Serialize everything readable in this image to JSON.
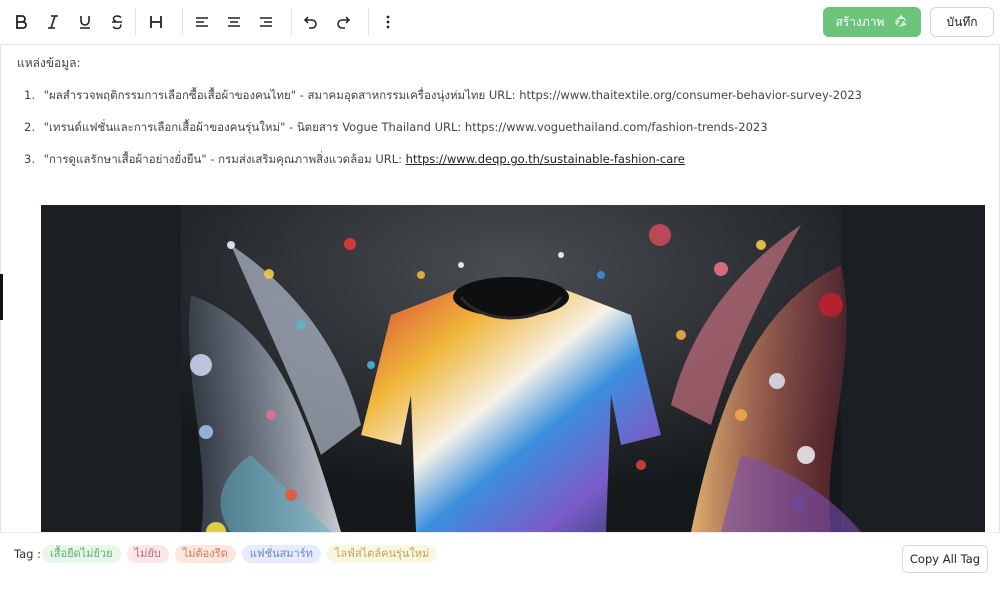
{
  "toolbar": {
    "tools": [
      {
        "name": "bold-icon"
      },
      {
        "name": "italic-icon"
      },
      {
        "name": "underline-icon"
      },
      {
        "name": "strikethrough-icon"
      },
      {
        "name": "heading-icon"
      },
      {
        "name": "align-left-icon"
      },
      {
        "name": "align-center-icon"
      },
      {
        "name": "align-right-icon"
      },
      {
        "name": "undo-icon"
      },
      {
        "name": "redo-icon"
      },
      {
        "name": "more-vertical-icon"
      }
    ],
    "generate_label": "สร้างภาพ",
    "generate_icon": "recycle-icon",
    "save_label": "บันทึก"
  },
  "sources": {
    "title": "แหล่งข้อมูล:",
    "items": [
      {
        "num": "1.",
        "text": "\"ผลสำรวจพฤติกรรมการเลือกซื้อเสื้อผ้าของคนไทย\" - สมาคมอุตสาหกรรมเครื่องนุ่งห่มไทย URL: https://www.thaitextile.org/consumer-behavior-survey-2023",
        "link": ""
      },
      {
        "num": "2.",
        "text": "\"เทรนด์แฟชั่นและการเลือกเสื้อผ้าของคนรุ่นใหม่\" - นิตยสาร Vogue Thailand URL: https://www.voguethailand.com/fashion-trends-2023",
        "link": ""
      },
      {
        "num": "3.",
        "text": "\"การดูแลรักษาเสื้อผ้าอย่างยั่งยืน\" - กรมส่งเสริมคุณภาพสิ่งแวดล้อม URL: ",
        "link": "https://www.deqp.go.th/sustainable-fashion-care"
      }
    ]
  },
  "tags": {
    "label": "Tag :",
    "items": [
      {
        "text": "เสื้อยืดไม่ย้วย",
        "bg": "#e8f7ea",
        "fg": "#5fae6b"
      },
      {
        "text": "ไม่ยับ",
        "bg": "#fbe6ea",
        "fg": "#c9646f"
      },
      {
        "text": "ไม่ต้องรีด",
        "bg": "#fbe7de",
        "fg": "#d07a58"
      },
      {
        "text": "แฟชั่นสมาร์ท",
        "bg": "#e6ecfb",
        "fg": "#6f86c9"
      },
      {
        "text": "ไลฟ์สไตล์คนรุ่นใหม่",
        "bg": "#fbf6e2",
        "fg": "#c2a552"
      }
    ],
    "copy_label": "Copy All Tag"
  }
}
